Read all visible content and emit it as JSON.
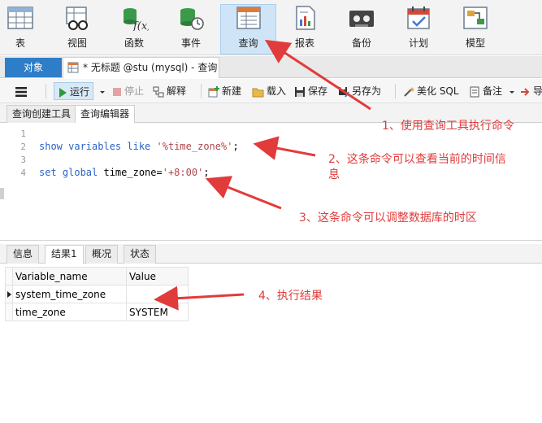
{
  "ribbon": {
    "items": [
      {
        "label": "表"
      },
      {
        "label": "视图"
      },
      {
        "label": "函数"
      },
      {
        "label": "事件"
      },
      {
        "label": "查询"
      },
      {
        "label": "报表"
      },
      {
        "label": "备份"
      },
      {
        "label": "计划"
      },
      {
        "label": "模型"
      }
    ],
    "active": "查询"
  },
  "tabs": {
    "objects": "对象",
    "query": "* 无标题 @stu (mysql) - 查询"
  },
  "toolbar": {
    "run": "运行",
    "stop": "停止",
    "explain": "解释",
    "new": "新建",
    "load": "载入",
    "save": "保存",
    "save_as": "另存为",
    "beautify": "美化 SQL",
    "note": "备注",
    "export": "导"
  },
  "subtabs": {
    "builder": "查询创建工具",
    "editor": "查询编辑器"
  },
  "editor": {
    "line_numbers": [
      "1",
      "2",
      "3",
      "4"
    ],
    "line2": {
      "kw": "show variables like",
      "str": "'%time_zone%'",
      "end": ";"
    },
    "line4": {
      "kw": "set global",
      "mid": " time_zone=",
      "str": "'+8:00'",
      "end": ";"
    }
  },
  "result_tabs": {
    "info": "信息",
    "result1": "结果1",
    "profile": "概况",
    "status": "状态"
  },
  "grid": {
    "headers": [
      "Variable_name",
      "Value"
    ],
    "rows": [
      [
        "system_time_zone",
        ""
      ],
      [
        "time_zone",
        "SYSTEM"
      ]
    ]
  },
  "annotations": {
    "a1": "1、使用查询工具执行命令",
    "a2_line1": "2、这条命令可以查看当前的时间信",
    "a2_line2": "息",
    "a3": "3、这条命令可以调整数据库的时区",
    "a4": "4、执行结果"
  },
  "colors": {
    "accent": "#2d7dc8",
    "annotation": "#e23b3b",
    "keyword": "#2a63c8",
    "string": "#b0454a"
  }
}
